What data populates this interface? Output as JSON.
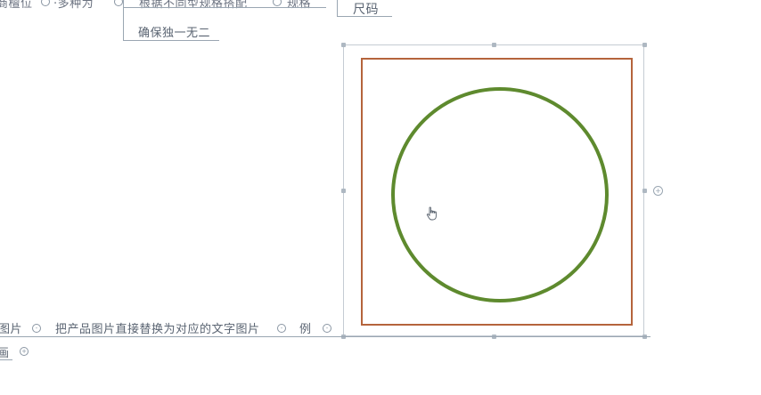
{
  "mindmap": {
    "top_row": {
      "fragment_1": "商檀位",
      "fragment_2": "·多种为",
      "fragment_3": "根据不同型规格搭配",
      "fragment_4": "规格"
    },
    "size_node": "尺码",
    "unique_node": "确保独一无二",
    "bottom_row": {
      "fragment_1": "图片",
      "replace_node": "把产品图片直接替换为对应的文字图片",
      "example_node": "例"
    },
    "bottom_left_fragment": "画"
  },
  "image_node": {
    "square_color": "#b5643c",
    "circle_color": "#5e8a2e"
  },
  "cursor": {
    "icon": "hand-pointer-icon"
  }
}
